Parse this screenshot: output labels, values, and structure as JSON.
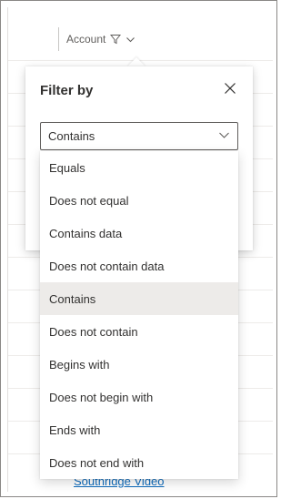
{
  "column_header": {
    "label": "Account",
    "filter_icon": "filter-icon",
    "chevron_icon": "chevron-down-icon"
  },
  "grid": {
    "partial_row_link": "Southridge Video"
  },
  "filter_panel": {
    "title": "Filter by",
    "close_icon": "close-icon",
    "operator_select": {
      "value": "Contains",
      "chevron_icon": "chevron-down-icon"
    }
  },
  "operator_options": [
    {
      "label": "Equals",
      "selected": false
    },
    {
      "label": "Does not equal",
      "selected": false
    },
    {
      "label": "Contains data",
      "selected": false
    },
    {
      "label": "Does not contain data",
      "selected": false
    },
    {
      "label": "Contains",
      "selected": true
    },
    {
      "label": "Does not contain",
      "selected": false
    },
    {
      "label": "Begins with",
      "selected": false
    },
    {
      "label": "Does not begin with",
      "selected": false
    },
    {
      "label": "Ends with",
      "selected": false
    },
    {
      "label": "Does not end with",
      "selected": false
    }
  ]
}
